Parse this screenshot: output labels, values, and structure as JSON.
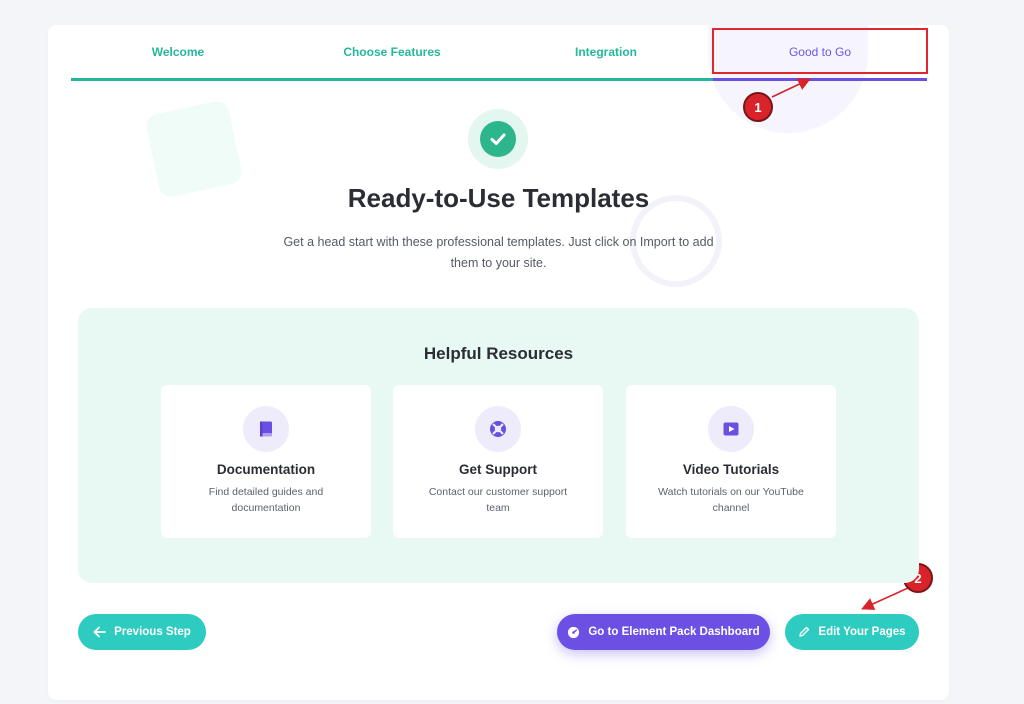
{
  "steps": [
    {
      "label": "Welcome"
    },
    {
      "label": "Choose Features"
    },
    {
      "label": "Integration"
    },
    {
      "label": "Good to Go"
    }
  ],
  "active_step": "Good to Go",
  "annotations": {
    "one": "1",
    "two": "2"
  },
  "hero": {
    "title": "Ready-to-Use Templates",
    "subtitle": "Get a head start with these professional templates. Just click on Import to add them to your site."
  },
  "resources": {
    "title": "Helpful Resources",
    "cards": [
      {
        "title": "Documentation",
        "description": "Find detailed guides and documentation",
        "icon": "book-icon"
      },
      {
        "title": "Get Support",
        "description": "Contact our customer support team",
        "icon": "lifebuoy-icon"
      },
      {
        "title": "Video Tutorials",
        "description": "Watch tutorials on our YouTube channel",
        "icon": "play-icon"
      }
    ]
  },
  "buttons": {
    "previous": "Previous Step",
    "dashboard": "Go to Element Pack Dashboard",
    "edit": "Edit Your Pages"
  },
  "colors": {
    "accent_green": "#26b89a",
    "accent_purple": "#6a4fe0",
    "button_teal": "#2ecbc0",
    "annotation_red": "#d8232a"
  }
}
